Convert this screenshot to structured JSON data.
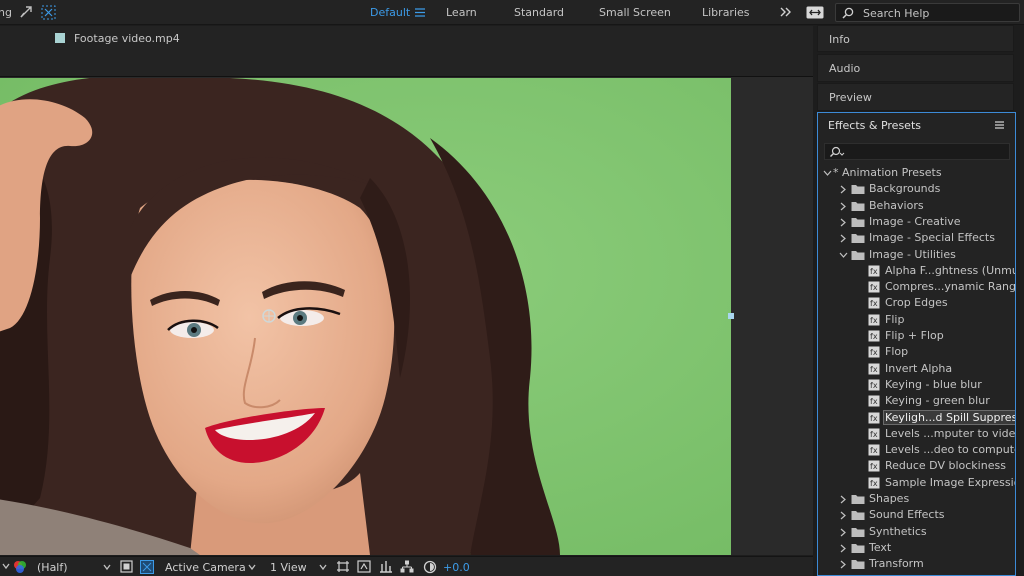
{
  "topbar": {
    "left_text": "ng",
    "workspaces": [
      "Default",
      "Learn",
      "Standard",
      "Small Screen",
      "Libraries"
    ],
    "active_workspace": "Default",
    "search_placeholder": "Search Help"
  },
  "comp": {
    "footage_name": "Footage video.mp4"
  },
  "viewer": {
    "resolution": "(Half)",
    "camera": "Active Camera",
    "views": "1 View",
    "exposure": "+0.0"
  },
  "panels": {
    "info": "Info",
    "audio": "Audio",
    "preview": "Preview"
  },
  "effects": {
    "title": "Effects & Presets",
    "tree": [
      {
        "label": "* Animation Presets",
        "type": "root"
      },
      {
        "label": "Backgrounds",
        "type": "folder"
      },
      {
        "label": "Behaviors",
        "type": "folder"
      },
      {
        "label": "Image - Creative",
        "type": "folder"
      },
      {
        "label": "Image - Special Effects",
        "type": "folder"
      },
      {
        "label": "Image - Utilities",
        "type": "folder-open"
      },
      {
        "label": "Alpha F...ghtness (Unmult)",
        "type": "preset"
      },
      {
        "label": "Compres...ynamic Range",
        "type": "preset"
      },
      {
        "label": "Crop Edges",
        "type": "preset"
      },
      {
        "label": "Flip",
        "type": "preset"
      },
      {
        "label": "Flip + Flop",
        "type": "preset"
      },
      {
        "label": "Flop",
        "type": "preset"
      },
      {
        "label": "Invert Alpha",
        "type": "preset"
      },
      {
        "label": "Keying - blue blur",
        "type": "preset"
      },
      {
        "label": "Keying - green blur",
        "type": "preset"
      },
      {
        "label": "Keyligh...d Spill Suppressor",
        "type": "preset-selected"
      },
      {
        "label": "Levels ...mputer to video",
        "type": "preset"
      },
      {
        "label": "Levels ...deo to computer",
        "type": "preset"
      },
      {
        "label": "Reduce DV blockiness",
        "type": "preset"
      },
      {
        "label": "Sample Image Expression",
        "type": "preset"
      },
      {
        "label": "Shapes",
        "type": "folder"
      },
      {
        "label": "Sound Effects",
        "type": "folder"
      },
      {
        "label": "Synthetics",
        "type": "folder"
      },
      {
        "label": "Text",
        "type": "folder"
      },
      {
        "label": "Transform",
        "type": "folder"
      }
    ]
  },
  "colors": {
    "accent": "#3c9be8",
    "panel_bg": "#232323",
    "green_screen": "#7fc46f"
  }
}
